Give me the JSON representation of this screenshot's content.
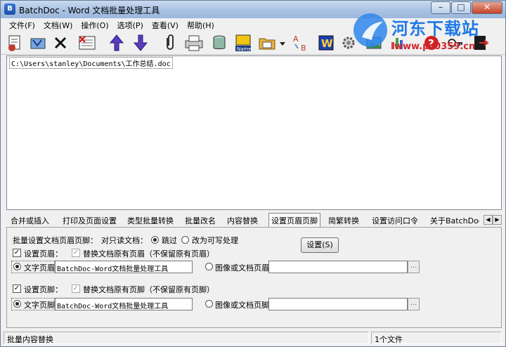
{
  "window": {
    "title": "BatchDoc - Word 文档批量处理工具",
    "caption": {
      "minimize": "–",
      "maximize": "□",
      "close": "✕"
    }
  },
  "watermark": {
    "text": "河东下载站",
    "url": "www.pc0359.cn"
  },
  "menu": [
    "文件(F)",
    "文档(W)",
    "操作(O)",
    "选项(P)",
    "查看(V)",
    "帮助(H)"
  ],
  "toolbar": {
    "icons": [
      "add-files-icon",
      "add-folder-icon",
      "delete-icon",
      "clear-list-icon",
      "move-up-icon",
      "move-down-icon",
      "attach-icon",
      "print-icon",
      "database-icon",
      "rename-icon",
      "open-folder-icon",
      "dropdown-icon",
      "replace-text-icon",
      "word-icon",
      "settings-icon",
      "picture-icon",
      "chart-icon",
      "help-icon",
      "key-icon",
      "exit-icon"
    ]
  },
  "file_list": [
    "C:\\Users\\stanley\\Documents\\工作总结.doc"
  ],
  "tabs": [
    "合并或插入",
    "打印及页面设置",
    "类型批量转换",
    "批量改名",
    "内容替换",
    "设置页眉页脚",
    "简繁转换",
    "设置访问口令",
    "关于BatchDoc"
  ],
  "active_tab": "设置页眉页脚",
  "tab_scroll": {
    "left": "◀",
    "right": "▶"
  },
  "panel": {
    "batch_label": "批量设置文档页眉页脚：",
    "readonly_label": "对只读文档：",
    "skip_label": "跳过",
    "make_writable_label": "改为可写处理",
    "set_button": "设置(S)",
    "header": {
      "enable_label": "设置页眉：",
      "replace_label": "替换文档原有页眉（不保留原有页眉）",
      "text_radio_label": "文字页眉",
      "text_value": "BatchDoc-Word文档批量处理工具",
      "image_radio_label": "图像或文档页眉",
      "image_value": "",
      "browse": "..."
    },
    "footer": {
      "enable_label": "设置页脚：",
      "replace_label": "替换文档原有页脚（不保留原有页脚）",
      "text_radio_label": "文字页脚",
      "text_value": "BatchDoc-Word文档批量处理工具",
      "image_radio_label": "图像或文档页脚",
      "image_value": "",
      "browse": "..."
    }
  },
  "status": {
    "left": "批量内容替换",
    "right": "1个文件"
  }
}
